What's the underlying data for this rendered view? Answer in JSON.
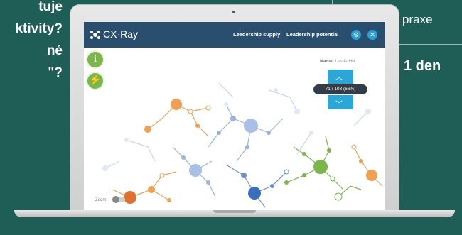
{
  "background": {
    "left_lines": [
      "tuje",
      "ktivity?",
      "né",
      "\"?"
    ],
    "right_top": "praxe",
    "right_big": "1 den"
  },
  "app": {
    "brand": "CX·Ray",
    "nav": [
      "Leadership supply",
      "Leadership potential"
    ],
    "icons": [
      "gear-icon",
      "close-icon"
    ],
    "side_buttons": [
      "info-icon",
      "lightning-icon"
    ],
    "name_label": "Name:",
    "name_value": "Leslie Hix",
    "score": "71 / 108 (66%)",
    "zoom_label": "Zoom:"
  },
  "colors": {
    "header": "#2a4e6d",
    "accent": "#2aa7d6",
    "green": "#7ab648",
    "orange": "#f0a050",
    "blue": "#3a6fc0"
  }
}
